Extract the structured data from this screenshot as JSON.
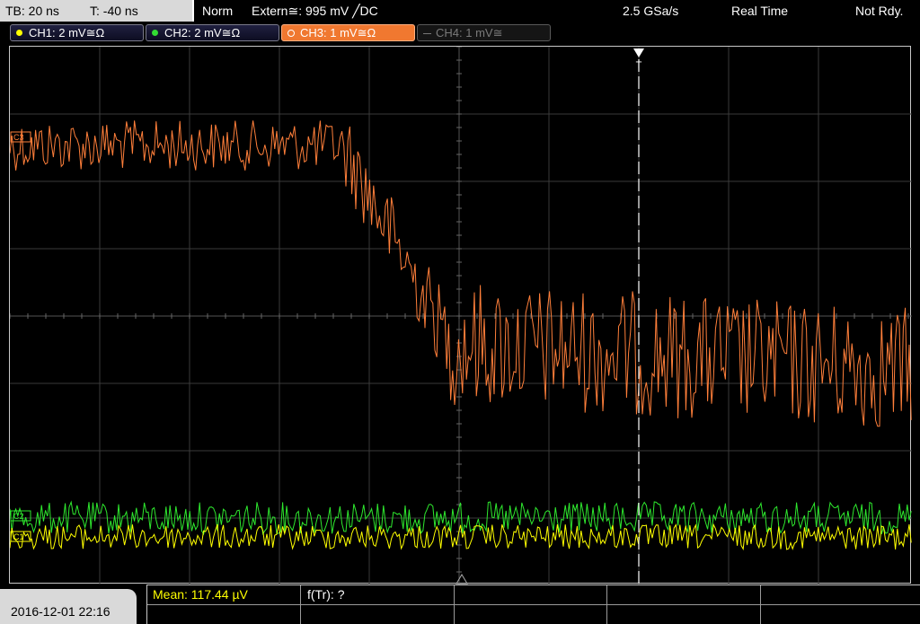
{
  "status": {
    "timebase": "TB: 20 ns",
    "trigger_time": "T: -40 ns",
    "mode": "Norm",
    "trigger_source": "Extern≅: 995 mV ╱DC",
    "sample_rate": "2.5 GSa/s",
    "acq_mode": "Real Time",
    "run_state": "Not Rdy."
  },
  "channels": [
    {
      "label": "CH1: 2 mV≅Ω",
      "color": "#ffff00",
      "state": "on"
    },
    {
      "label": "CH2: 2 mV≅Ω",
      "color": "#33dd33",
      "state": "on"
    },
    {
      "label": "CH3: 1 mV≅Ω",
      "color": "#f07830",
      "state": "active"
    },
    {
      "label": "CH4: 1 mV≅",
      "color": "#777777",
      "state": "off"
    }
  ],
  "markers": {
    "ch3": "C3",
    "ch2": "C2",
    "ch1": "C1",
    "trigger": "T"
  },
  "trace_colors": {
    "ch1": "#ffff00",
    "ch2": "#2ee82e",
    "ch3": "#ff7f3a"
  },
  "measurements": {
    "mean": "Mean: 117.44 µV",
    "rise_freq": "f(Tr): ?"
  },
  "datetime": "2016-12-01 22:16"
}
